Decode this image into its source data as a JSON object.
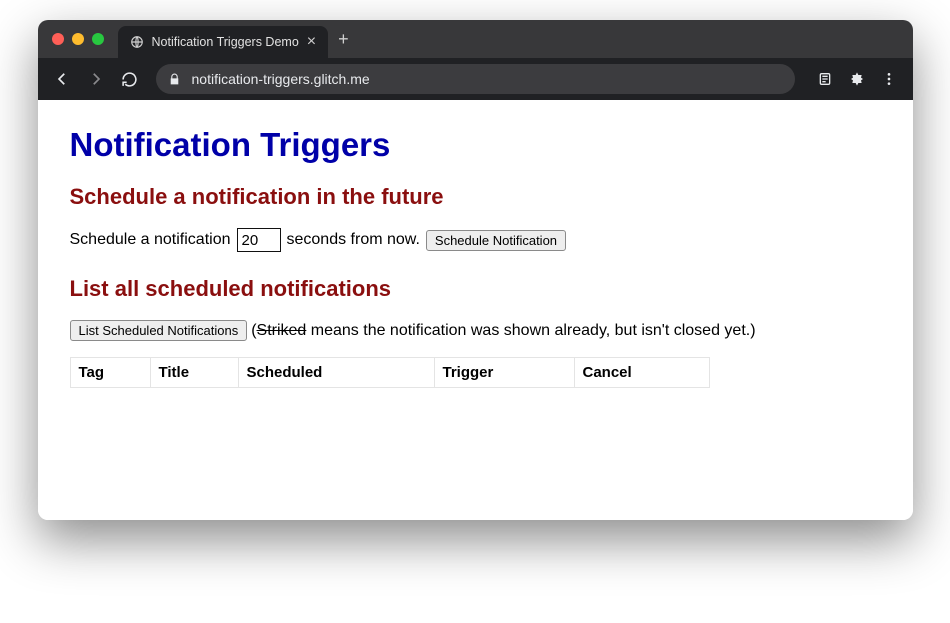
{
  "browser": {
    "tab_title": "Notification Triggers Demo",
    "url": "notification-triggers.glitch.me"
  },
  "heading": "Notification Triggers",
  "schedule": {
    "heading": "Schedule a notification in the future",
    "prefix": "Schedule a notification",
    "seconds_value": "20",
    "suffix": "seconds from now.",
    "button": "Schedule Notification"
  },
  "list": {
    "heading": "List all scheduled notifications",
    "button": "List Scheduled Notifications",
    "hint_open": "(",
    "hint_striked": "Striked",
    "hint_rest": " means the notification was shown already, but isn't closed yet.)",
    "columns": {
      "tag": "Tag",
      "title": "Title",
      "scheduled": "Scheduled",
      "trigger": "Trigger",
      "cancel": "Cancel"
    }
  }
}
